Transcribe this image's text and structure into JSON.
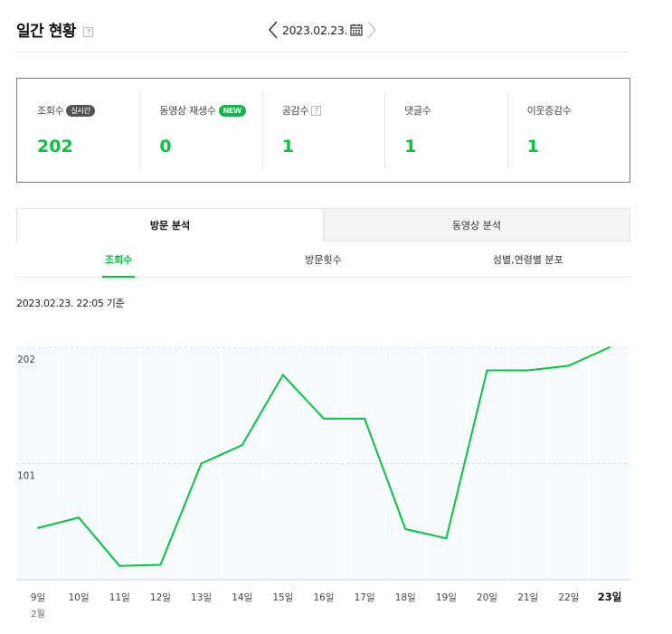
{
  "header": {
    "title": "일간 현황",
    "help": "?",
    "date": "2023.02.23."
  },
  "summary": [
    {
      "label": "조회수",
      "badge": "실시간",
      "badge_style": "gray",
      "value": "202"
    },
    {
      "label": "동영상 재생수",
      "badge": "NEW",
      "badge_style": "green",
      "value": "0"
    },
    {
      "label": "공감수",
      "help": "?",
      "value": "1"
    },
    {
      "label": "댓글수",
      "value": "1"
    },
    {
      "label": "이웃증감수",
      "value": "1"
    }
  ],
  "tabs": [
    {
      "label": "방문 분석",
      "active": true
    },
    {
      "label": "동영상 분석",
      "active": false
    }
  ],
  "subtabs": [
    {
      "label": "조회수",
      "active": true
    },
    {
      "label": "방문횟수",
      "active": false
    },
    {
      "label": "성별,연령별 분포",
      "active": false
    }
  ],
  "basis": "2023.02.23. 22:05 기준",
  "colors": {
    "accent": "#00c73c",
    "plot_bg": "#f7fbff"
  },
  "chart_data": {
    "type": "line",
    "x": [
      "9일",
      "10일",
      "11일",
      "12일",
      "13일",
      "14일",
      "15일",
      "16일",
      "17일",
      "18일",
      "19일",
      "20일",
      "21일",
      "22일",
      "23일"
    ],
    "x_sublabel": "2월",
    "values": [
      45,
      54,
      12,
      13,
      101,
      117,
      178,
      140,
      140,
      44,
      36,
      182,
      182,
      186,
      202
    ],
    "y_ticks": [
      202,
      101
    ],
    "ylim": [
      0,
      202
    ],
    "grid": true,
    "highlight_last": true
  }
}
